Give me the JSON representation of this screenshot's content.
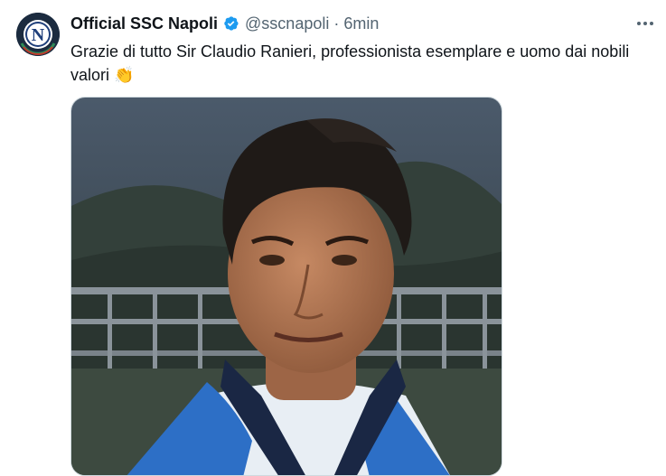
{
  "tweet": {
    "author_name": "Official SSC Napoli",
    "handle": "@sscnapoli",
    "separator": "·",
    "time": "6min",
    "text": "Grazie di tutto Sir Claudio Ranieri, professionista esemplare e uomo dai nobili valori",
    "emoji": "👏",
    "avatar_letter": "N"
  },
  "icons": {
    "verified": "verified-badge-icon",
    "more": "more-options-icon"
  },
  "colors": {
    "verified": "#1d9bf0",
    "secondary_text": "#536471",
    "avatar_bg": "#1b2b3f"
  }
}
